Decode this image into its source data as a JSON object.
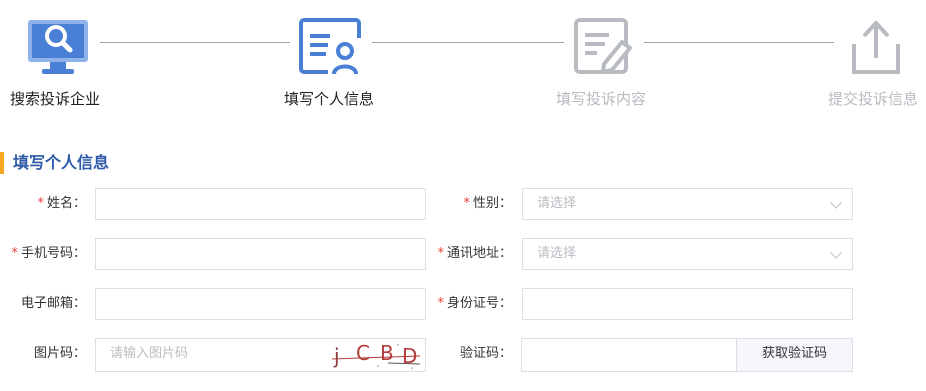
{
  "stepper": {
    "steps": [
      {
        "label": "搜索投诉企业",
        "state": "done",
        "icon": "monitor-search-icon"
      },
      {
        "label": "填写个人信息",
        "state": "active",
        "icon": "profile-form-icon"
      },
      {
        "label": "填写投诉内容",
        "state": "todo",
        "icon": "edit-document-icon"
      },
      {
        "label": "提交投诉信息",
        "state": "todo",
        "icon": "upload-icon"
      }
    ]
  },
  "section": {
    "title": "填写个人信息"
  },
  "form": {
    "required_mark": "*",
    "name": {
      "label": "姓名：",
      "value": ""
    },
    "gender": {
      "label": "性别：",
      "placeholder": "请选择"
    },
    "phone": {
      "label": "手机号码：",
      "value": ""
    },
    "address": {
      "label": "通讯地址：",
      "placeholder": "请选择"
    },
    "email": {
      "label": "电子邮箱：",
      "value": ""
    },
    "id_number": {
      "label": "身份证号：",
      "value": ""
    },
    "image_code": {
      "label": "图片码：",
      "placeholder": "请输入图片码",
      "captcha_text": "jCBD"
    },
    "sms_code": {
      "label": "验证码：",
      "value": "",
      "button": "获取验证码"
    }
  },
  "colors": {
    "accent_blue": "#2d5aa8",
    "icon_blue": "#4a7fd6",
    "icon_light": "#8fb2ea",
    "inactive_gray": "#b8bcc2",
    "title_bar": "#f5a623",
    "required": "#e8413a"
  }
}
